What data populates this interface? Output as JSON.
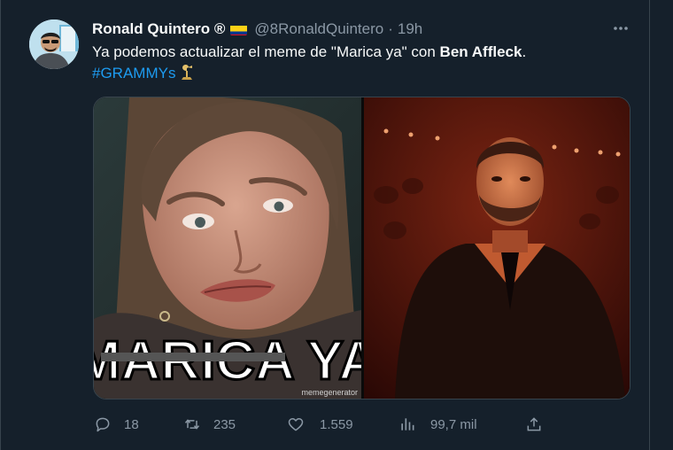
{
  "tweet": {
    "author_name": "Ronald Quintero ®",
    "handle": "@8RonaldQuintero",
    "separator": "·",
    "time": "19h",
    "text_prefix": "Ya podemos actualizar el meme de \"Marica ya\" con ",
    "text_bold": "Ben Affleck",
    "text_suffix": ".",
    "hashtag": "#GRAMMYs"
  },
  "media": {
    "caption_struck": "MARICA",
    "caption_rest": "YA",
    "watermark": "memegenerator"
  },
  "actions": {
    "replies": "18",
    "retweets": "235",
    "likes": "1.559",
    "views": "99,7 mil"
  },
  "colors": {
    "background": "#15202b",
    "accent": "#1d9bf0",
    "muted_text": "#8b98a5"
  },
  "icons": [
    "flag-colombia-icon",
    "more-icon",
    "grammy-icon",
    "reply-icon",
    "retweet-icon",
    "like-icon",
    "views-icon",
    "share-icon"
  ]
}
